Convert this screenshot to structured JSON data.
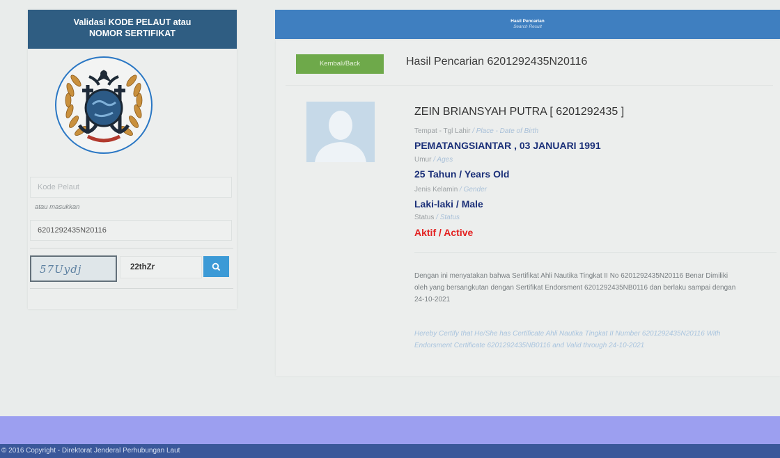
{
  "left_panel": {
    "title_line1": "Validasi KODE PELAUT atau",
    "title_line2": "NOMOR SERTIFIKAT",
    "kode_pelaut_placeholder": "Kode Pelaut",
    "or_note": "atau masukkan",
    "certificate_number": "6201292435N20116",
    "captcha_text": "57Uydj",
    "captcha_input": "22thZr"
  },
  "result_header": {
    "title": "Hasil Pencarian",
    "subtitle": "Search Result"
  },
  "result": {
    "back_button": "Kembali/Back",
    "title": "Hasil Pencarian 6201292435N20116",
    "name": "ZEIN BRIANSYAH PUTRA [ 6201292435 ]",
    "birth_label": "Tempat - Tgl Lahir",
    "birth_label_en": "/ Place - Date of Birth",
    "birth_value": "PEMATANGSIANTAR , 03 JANUARI 1991",
    "age_label": "Umur",
    "age_label_en": "/ Ages",
    "age_value": "25 Tahun / Years Old",
    "gender_label": "Jenis Kelamin",
    "gender_label_en": "/ Gender",
    "gender_value": "Laki-laki / Male",
    "status_label": "Status",
    "status_label_en": "/ Status",
    "status_value": "Aktif / Active",
    "statement": "Dengan ini menyatakan bahwa Sertifikat Ahli Nautika Tingkat II No 6201292435N20116 Benar Dimiliki oleh yang bersangkutan dengan Sertifikat Endorsment 6201292435NB0116 dan berlaku sampai dengan 24-10-2021",
    "statement_en": "Hereby Certify that He/She has Certificate Ahli Nautika Tingkat II Number 6201292435N20116 With Endorsment Certificate 6201292435NB0116 and Valid through 24-10-2021"
  },
  "footer": {
    "copyright": "© 2016 Copyright - Direktorat Jenderal Perhubungan Laut"
  },
  "colors": {
    "header_left": "#2f5d82",
    "header_right": "#3f7fc0",
    "back_button": "#6ea94a",
    "value_text": "#1a2f78",
    "status_active": "#e32121",
    "footer": "#3a589a"
  }
}
